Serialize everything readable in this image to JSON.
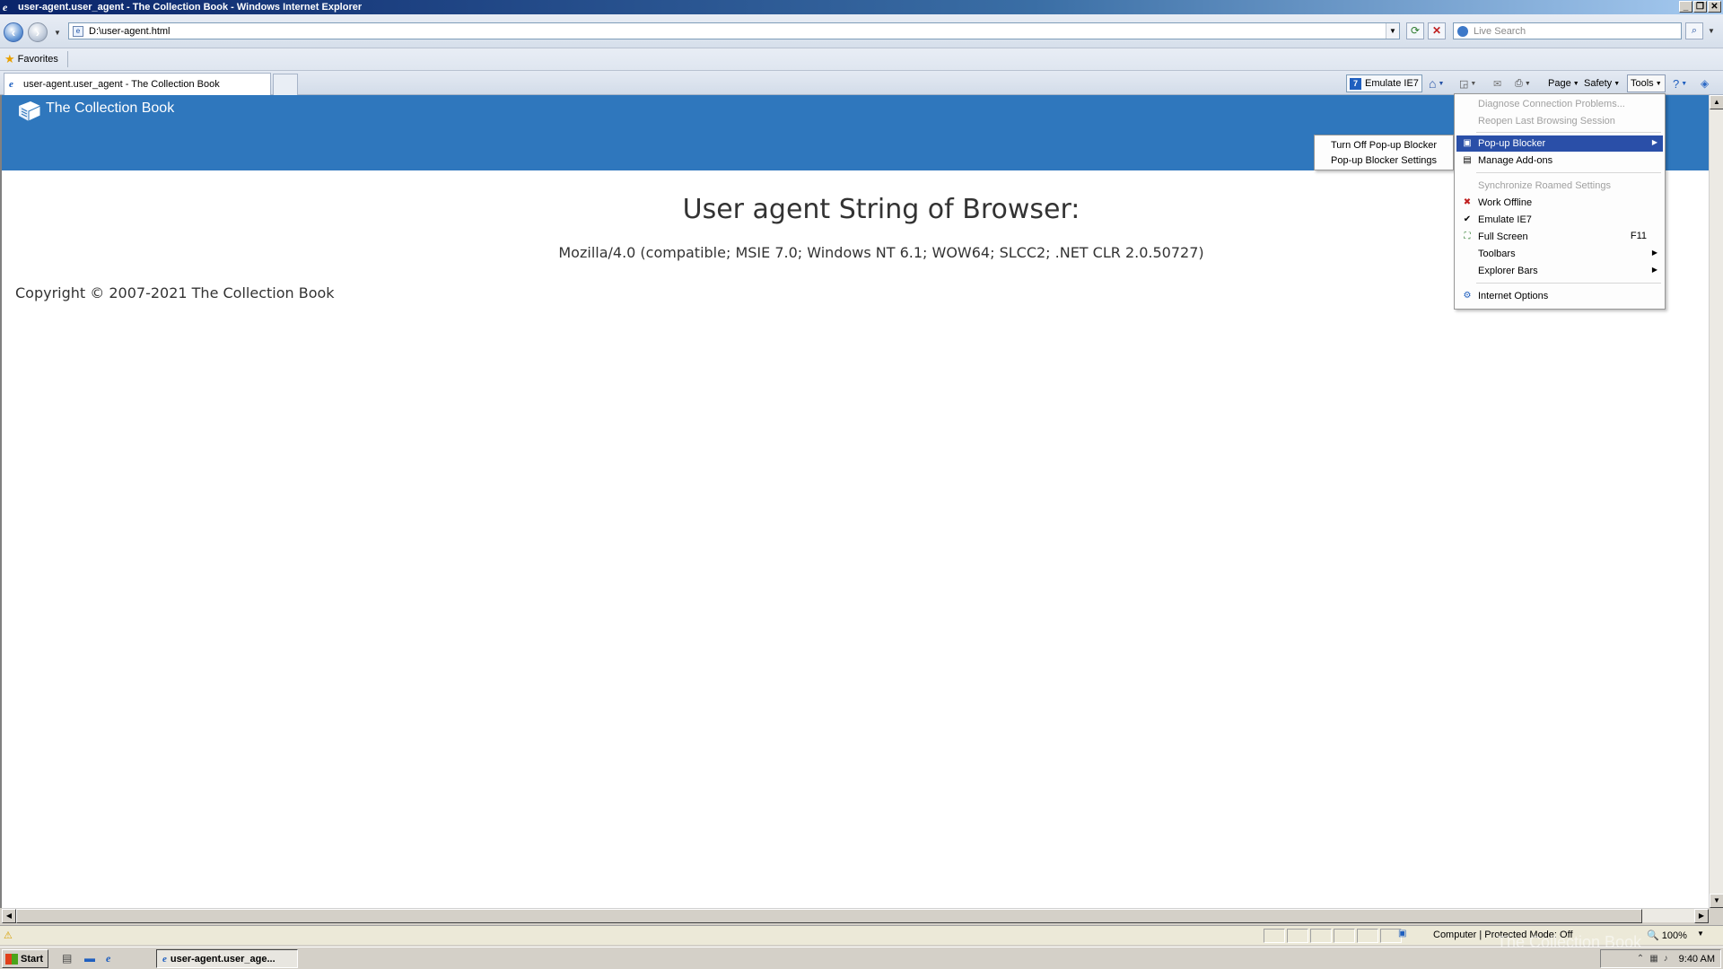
{
  "window": {
    "title": "user-agent.user_agent - The Collection Book - Windows Internet Explorer",
    "buttons": {
      "minimize": "_",
      "restore": "❐",
      "close": "✕"
    }
  },
  "address_bar": {
    "url": "D:\\user-agent.html",
    "search_placeholder": "Live Search"
  },
  "favorites_bar": {
    "label": "Favorites"
  },
  "tabs": [
    {
      "label": "user-agent.user_agent - The Collection Book"
    }
  ],
  "command_bar": {
    "emulate": "Emulate IE7",
    "page": "Page",
    "safety": "Safety",
    "tools": "Tools"
  },
  "page": {
    "brand": "The Collection Book",
    "heading": "User agent String of Browser:",
    "user_agent": "Mozilla/4.0 (compatible; MSIE 7.0; Windows NT 6.1; WOW64; SLCC2; .NET CLR 2.0.50727)",
    "copyright": "Copyright © 2007-2021 The Collection Book",
    "banner_color": "#2f77bd"
  },
  "tools_menu": {
    "items": [
      {
        "label": "Diagnose Connection Problems...",
        "disabled": true
      },
      {
        "label": "Reopen Last Browsing Session",
        "disabled": true
      },
      {
        "label": "Pop-up Blocker",
        "highlighted": true,
        "submenu": true,
        "icon": "popup-blocker-icon"
      },
      {
        "label": "Manage Add-ons",
        "icon": "addons-icon"
      },
      {
        "label": "Synchronize Roamed Settings",
        "disabled": true
      },
      {
        "label": "Work Offline",
        "icon": "work-offline-icon"
      },
      {
        "label": "Emulate IE7",
        "checked": true
      },
      {
        "label": "Full Screen",
        "shortcut": "F11",
        "icon": "full-screen-icon"
      },
      {
        "label": "Toolbars",
        "submenu": true
      },
      {
        "label": "Explorer Bars",
        "submenu": true
      },
      {
        "label": "Internet Options",
        "icon": "internet-options-icon"
      }
    ]
  },
  "popup_submenu": {
    "items": [
      {
        "label": "Turn Off Pop-up Blocker"
      },
      {
        "label": "Pop-up Blocker Settings"
      }
    ]
  },
  "status_bar": {
    "zone": "Computer | Protected Mode: Off",
    "zoom": "100%"
  },
  "taskbar": {
    "start": "Start",
    "active_window": "user-agent.user_age...",
    "clock": "9:40 AM"
  },
  "watermark": "The Collection Book"
}
